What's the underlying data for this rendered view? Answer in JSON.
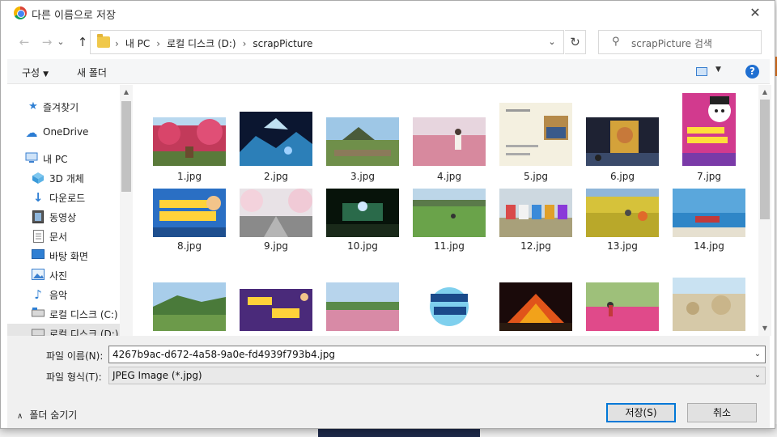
{
  "window": {
    "title": "다른 이름으로 저장",
    "close_glyph": "✕"
  },
  "nav": {
    "back_glyph": "←",
    "forward_glyph": "→",
    "up_glyph": "↑",
    "breadcrumb": [
      "내 PC",
      "로컬 디스크 (D:)",
      "scrapPicture"
    ],
    "search_placeholder": "scrapPicture 검색"
  },
  "toolbar": {
    "organize_label": "구성",
    "new_folder_label": "새 폴더",
    "help_label": "?"
  },
  "sidebar": {
    "items": [
      {
        "label": "즐겨찾기",
        "icon": "star-icon"
      },
      {
        "label": "OneDrive",
        "icon": "cloud-icon"
      },
      {
        "label": "내 PC",
        "icon": "computer-icon"
      },
      {
        "label": "3D 개체",
        "icon": "cube-icon"
      },
      {
        "label": "다운로드",
        "icon": "download-icon"
      },
      {
        "label": "동영상",
        "icon": "video-icon"
      },
      {
        "label": "문서",
        "icon": "document-icon"
      },
      {
        "label": "바탕 화면",
        "icon": "desktop-icon"
      },
      {
        "label": "사진",
        "icon": "picture-icon"
      },
      {
        "label": "음악",
        "icon": "music-icon"
      },
      {
        "label": "로컬 디스크 (C:)",
        "icon": "drive-icon"
      },
      {
        "label": "로컬 디스크 (D:)",
        "icon": "drive-icon"
      }
    ]
  },
  "files": [
    {
      "name": "1.jpg"
    },
    {
      "name": "2.jpg"
    },
    {
      "name": "3.jpg"
    },
    {
      "name": "4.jpg"
    },
    {
      "name": "5.jpg"
    },
    {
      "name": "6.jpg"
    },
    {
      "name": "7.jpg"
    },
    {
      "name": "8.jpg"
    },
    {
      "name": "9.jpg"
    },
    {
      "name": "10.jpg"
    },
    {
      "name": "11.jpg"
    },
    {
      "name": "12.jpg"
    },
    {
      "name": "13.jpg"
    },
    {
      "name": "14.jpg"
    },
    {
      "name": ""
    },
    {
      "name": ""
    },
    {
      "name": ""
    },
    {
      "name": ""
    },
    {
      "name": ""
    },
    {
      "name": ""
    },
    {
      "name": ""
    }
  ],
  "form": {
    "filename_label": "파일 이름(N):",
    "filename_value": "4267b9ac-d672-4a58-9a0e-fd4939f793b4.jpg",
    "filetype_label": "파일 형식(T):",
    "filetype_value": "JPEG Image (*.jpg)"
  },
  "footer": {
    "hide_folders_label": "폴더 숨기기",
    "save_label": "저장(S)",
    "cancel_label": "취소"
  },
  "colors": {
    "accent": "#0078d7",
    "help_blue": "#1f6fd1",
    "folder_yellow": "#f0c84a"
  }
}
